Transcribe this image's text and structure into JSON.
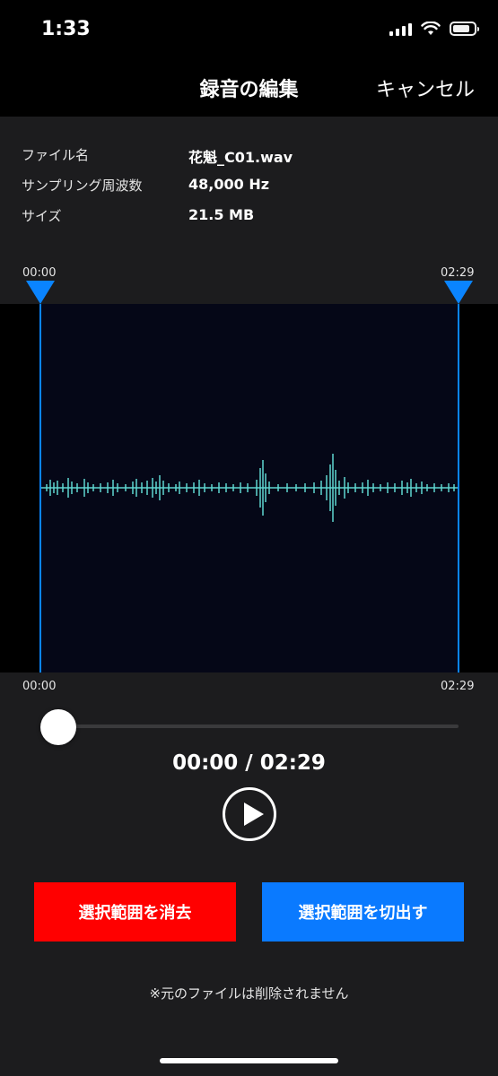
{
  "status": {
    "time": "1:33",
    "icons": [
      "signal-icon",
      "wifi-icon",
      "battery-icon"
    ]
  },
  "nav": {
    "title": "録音の編集",
    "cancel_label": "キャンセル"
  },
  "file_info": {
    "rows": [
      {
        "label": "ファイル名",
        "value": "花魁_C01.wav"
      },
      {
        "label": "サンプリング周波数",
        "value": "48,000 Hz"
      },
      {
        "label": "サイズ",
        "value": "21.5 MB"
      }
    ]
  },
  "range": {
    "start_label_top": "00:00",
    "end_label_top": "02:29",
    "start_label_bottom": "00:00",
    "end_label_bottom": "02:29"
  },
  "player": {
    "time_display": "00:00 / 02:29",
    "progress": 0
  },
  "actions": {
    "delete_label": "選択範囲を消去",
    "cut_label": "選択範囲を切出す"
  },
  "footnote": "※元のファイルは削除されません",
  "colors": {
    "accent": "#0a84ff",
    "delete": "#ff0000",
    "cut": "#0a7aff",
    "waveform": "#5fd6d0",
    "waveform_bg": "#050717"
  }
}
